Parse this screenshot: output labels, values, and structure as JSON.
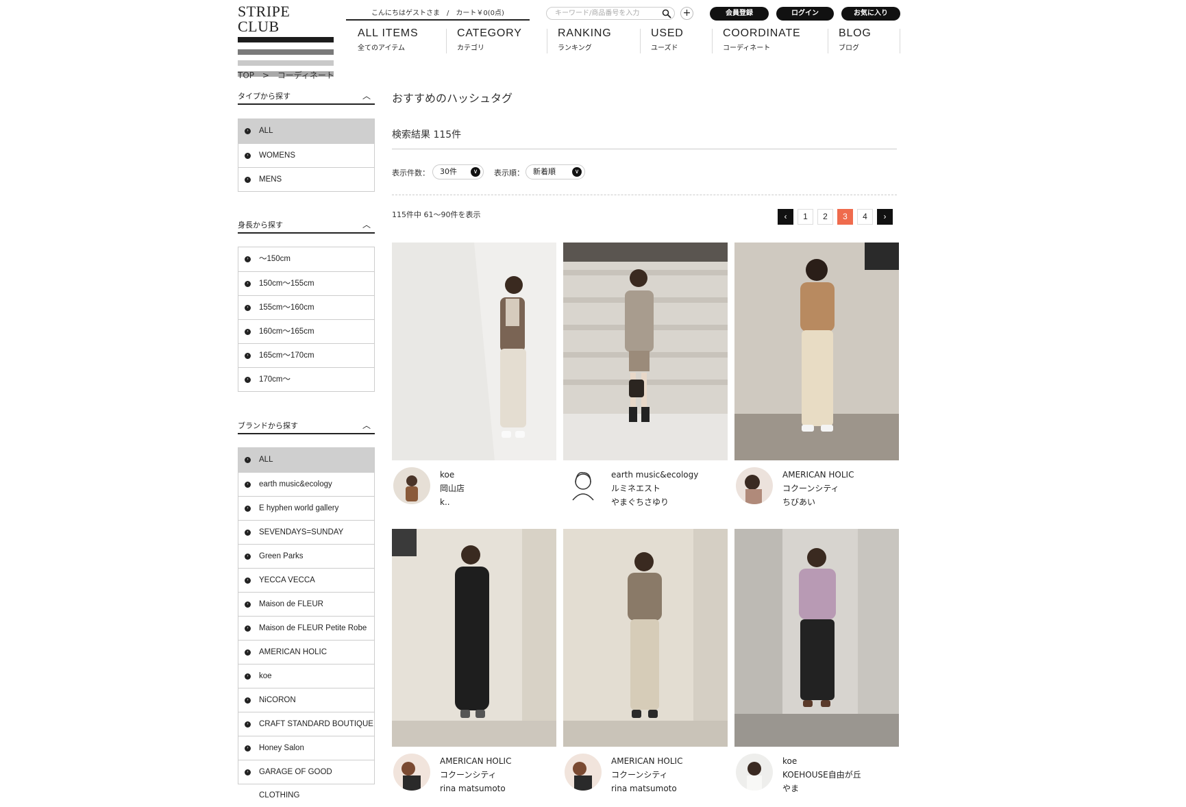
{
  "header": {
    "logo": "STRIPE CLUB",
    "greeting": "こんにちはゲストさま　/　カート￥0(0点)",
    "search_placeholder": "キーワード/商品番号を入力",
    "register": "会員登録",
    "login": "ログイン",
    "favorites": "お気に入り"
  },
  "nav": [
    {
      "en": "ALL ITEMS",
      "jp": "全てのアイテム"
    },
    {
      "en": "CATEGORY",
      "jp": "カテゴリ"
    },
    {
      "en": "RANKING",
      "jp": "ランキング"
    },
    {
      "en": "USED",
      "jp": "ユーズド"
    },
    {
      "en": "COORDINATE",
      "jp": "コーディネート"
    },
    {
      "en": "BLOG",
      "jp": "ブログ"
    }
  ],
  "breadcrumb": {
    "top": "TOP",
    "sep": ">",
    "current": "コーディネート"
  },
  "sidebar": {
    "type": {
      "title": "タイプから探す",
      "items": [
        "ALL",
        "WOMENS",
        "MENS"
      ]
    },
    "height": {
      "title": "身長から探す",
      "items": [
        "〜150cm",
        "150cm〜155cm",
        "155cm〜160cm",
        "160cm〜165cm",
        "165cm〜170cm",
        "170cm〜"
      ]
    },
    "brand": {
      "title": "ブランドから探す",
      "items": [
        "ALL",
        "earth music&ecology",
        "E hyphen world gallery",
        "SEVENDAYS=SUNDAY",
        "Green Parks",
        "YECCA VECCA",
        "Maison de FLEUR",
        "Maison de FLEUR Petite Robe",
        "AMERICAN HOLIC",
        "koe",
        "NiCORON",
        "CRAFT STANDARD BOUTIQUE",
        "Honey Salon",
        "GARAGE OF GOOD CLOTHING"
      ]
    }
  },
  "main": {
    "title": "おすすめのハッシュタグ",
    "result": "検索結果 115件",
    "per_page_label": "表示件数：",
    "per_page_value": "30件",
    "sort_label": "表示順：",
    "sort_value": "新着順",
    "count_text": "115件中 61〜90件を表示",
    "pages": [
      "‹",
      "1",
      "2",
      "3",
      "4",
      "›"
    ],
    "current_page": "3"
  },
  "cards": [
    {
      "brand": "koe",
      "shop": "岡山店",
      "staff": "k.."
    },
    {
      "brand": "earth music&ecology",
      "shop": "ルミネエスト",
      "staff": "やまぐちさゆり"
    },
    {
      "brand": "AMERICAN HOLIC",
      "shop": "コクーンシティ",
      "staff": "ちびあい"
    },
    {
      "brand": "AMERICAN HOLIC",
      "shop": "コクーンシティ",
      "staff": "rina matsumoto"
    },
    {
      "brand": "AMERICAN HOLIC",
      "shop": "コクーンシティ",
      "staff": "rina matsumoto"
    },
    {
      "brand": "koe",
      "shop": "KOEHOUSE自由が丘",
      "staff": "やま"
    }
  ],
  "colors": {
    "accent": "#ef6b4d",
    "dark": "#111111",
    "active_bg": "#cfcfcf"
  }
}
